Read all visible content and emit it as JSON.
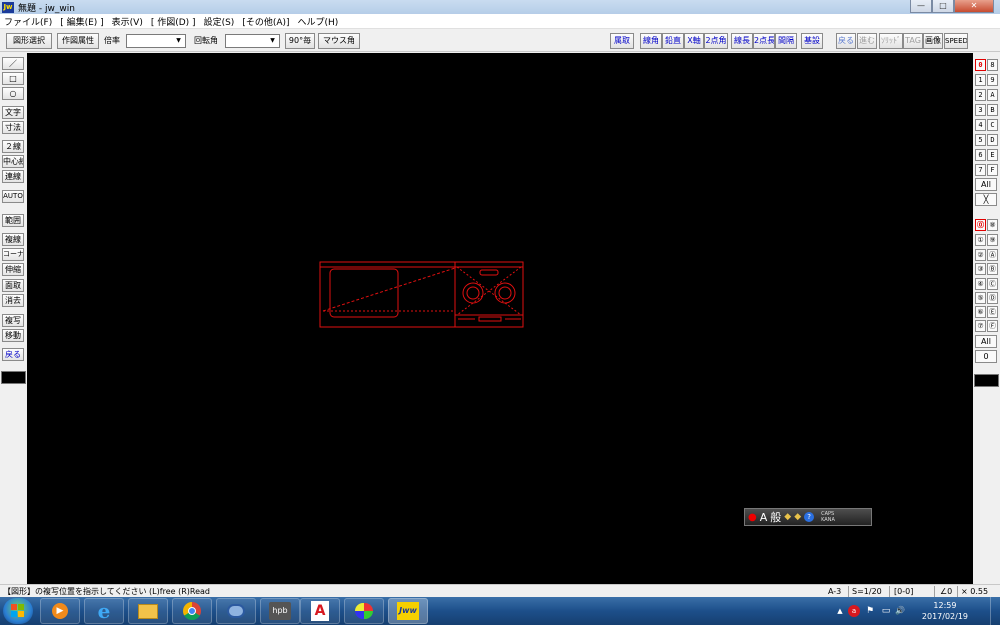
{
  "window": {
    "title": "無題 - jw_win",
    "app_icon": "Jw",
    "min_label": "—",
    "max_label": "□",
    "close_label": "✕"
  },
  "menu": [
    "ファイル(F)",
    "[ 編集(E) ]",
    "表示(V)",
    "[ 作図(D) ]",
    "設定(S)",
    "[その他(A)]",
    "ヘルプ(H)"
  ],
  "toolbar": {
    "zukei_sentaku": "図形選択",
    "sakuzu_zokusei": "作図属性",
    "bairitsu_label": "倍率",
    "bairitsu_value": "",
    "kaitenkaku_label": "回転角",
    "kaitenkaku_value": "",
    "deg90": "90°毎",
    "mouse_kaku": "マウス角",
    "right_buttons": [
      "属取",
      "線角",
      "鉛直",
      "X軸",
      "2点角",
      "線長",
      "2点長",
      "間隔",
      "基設"
    ],
    "dim_buttons": [
      "戻る",
      "進む",
      "ｿﾘｯﾄﾞ",
      "TAG"
    ],
    "gazou": "画像",
    "speed": "SPEED"
  },
  "left_tools": [
    "／",
    "□",
    "○",
    "文字",
    "寸法",
    "２線",
    "中心線",
    "連線",
    "AUTO",
    "範囲",
    "複線",
    "コーナー",
    "伸縮",
    "面取",
    "消去",
    "複写",
    "移動",
    "戻る"
  ],
  "right_layers_left": [
    "0",
    "1",
    "2",
    "3",
    "4",
    "5",
    "6",
    "7"
  ],
  "right_layers_right": [
    "8",
    "9",
    "A",
    "B",
    "C",
    "D",
    "E",
    "F"
  ],
  "right_all": "All",
  "right_cross": "╳",
  "right_groups_left": [
    "⓪",
    "①",
    "②",
    "③",
    "④",
    "⑤",
    "⑥",
    "⑦"
  ],
  "right_groups_right": [
    "⑧",
    "⑨",
    "Ⓐ",
    "Ⓑ",
    "Ⓒ",
    "Ⓓ",
    "Ⓔ",
    "Ⓕ"
  ],
  "right_all2": "All",
  "right_zero": "0",
  "ime": {
    "mode": "A",
    "kanji": "般",
    "caps": "CAPS",
    "kana": "KANA"
  },
  "status": {
    "message": "【図形】の複写位置を指示してください (L)free (R)Read",
    "paper": "A-3",
    "scale": "S=1/20",
    "layer": "[0-0]",
    "angle": "∠0",
    "zoom": "× 0.55"
  },
  "taskbar": {
    "time": "12:59",
    "date": "2017/02/19",
    "apps": [
      "media",
      "ie",
      "explorer",
      "chrome",
      "thunderbird",
      "hpb",
      "acrobat",
      "paint",
      "jww"
    ],
    "hpb_label": "hpb",
    "jww_label": "Jww",
    "acrobat_label": "A"
  },
  "tray": {
    "chevron": "▲",
    "flag": "⚑",
    "net": "▭",
    "vol": "🔊"
  },
  "colors": {
    "canvas": "#000000",
    "drawing": "#e01010",
    "active_layer": "#e00000",
    "blue_text": "#0000c8"
  }
}
